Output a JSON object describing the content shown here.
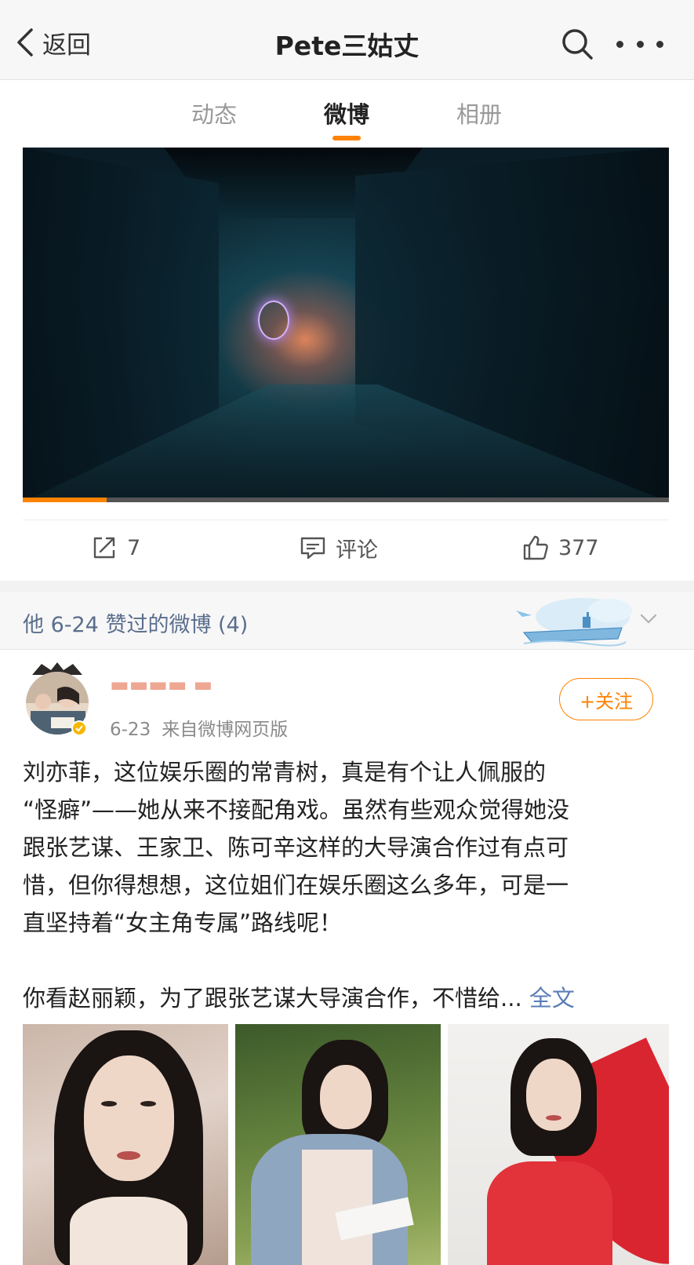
{
  "nav": {
    "back_label": "返回",
    "title": "Pete三姑丈",
    "search_icon": "search-icon",
    "more_icon": "more-icon"
  },
  "tabs": [
    {
      "label": "动态",
      "active": false
    },
    {
      "label": "微博",
      "active": true
    },
    {
      "label": "相册",
      "active": false
    }
  ],
  "colors": {
    "accent": "#ff8200",
    "link": "#5b7db7",
    "header_text": "#5a6e8c"
  },
  "video": {
    "progress": 0.13
  },
  "actions": {
    "repost_count": "7",
    "comment_label": "评论",
    "like_count": "377"
  },
  "liked_section": {
    "title": "他 6-24 赞过的微博 (4)"
  },
  "post": {
    "date": "6-23",
    "source": "来自微博网页版",
    "follow_label": "+关注",
    "lines": [
      "刘亦菲，这位娱乐圈的常青树，真是有个让人佩服的",
      "“怪癖”——她从来不接配角戏。虽然有些观众觉得她没",
      "跟张艺谋、王家卫、陈可辛这样的大导演合作过有点可",
      "惜，但你得想想，这位姐们在娱乐圈这么多年，可是一",
      "直坚持着“女主角专属”路线呢！"
    ],
    "last_line": "你看赵丽颖，为了跟张艺谋大导演合作，不惜给...",
    "full_text_link": "全文"
  }
}
